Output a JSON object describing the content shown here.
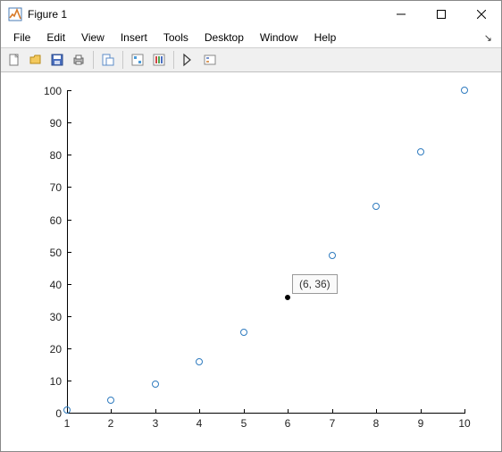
{
  "window": {
    "title": "Figure 1"
  },
  "menu": {
    "file": "File",
    "edit": "Edit",
    "view": "View",
    "insert": "Insert",
    "tools": "Tools",
    "desktop": "Desktop",
    "window": "Window",
    "help": "Help"
  },
  "datatip": {
    "text": "(6, 36)"
  },
  "chart_data": {
    "type": "scatter",
    "x": [
      1,
      2,
      3,
      4,
      5,
      6,
      7,
      8,
      9,
      10
    ],
    "y": [
      1,
      4,
      9,
      16,
      25,
      36,
      49,
      64,
      81,
      100
    ],
    "title": "",
    "xlabel": "",
    "ylabel": "",
    "xlim": [
      1,
      10
    ],
    "ylim": [
      0,
      100
    ],
    "xticks": [
      1,
      2,
      3,
      4,
      5,
      6,
      7,
      8,
      9,
      10
    ],
    "yticks": [
      0,
      10,
      20,
      30,
      40,
      50,
      60,
      70,
      80,
      90,
      100
    ],
    "selected_point": {
      "x": 6,
      "y": 36
    }
  },
  "ticklabels": {
    "x": {
      "0": "1",
      "1": "2",
      "2": "3",
      "3": "4",
      "4": "5",
      "5": "6",
      "6": "7",
      "7": "8",
      "8": "9",
      "9": "10"
    },
    "y": {
      "0": "0",
      "1": "10",
      "2": "20",
      "3": "30",
      "4": "40",
      "5": "50",
      "6": "60",
      "7": "70",
      "8": "80",
      "9": "90",
      "10": "100"
    }
  }
}
